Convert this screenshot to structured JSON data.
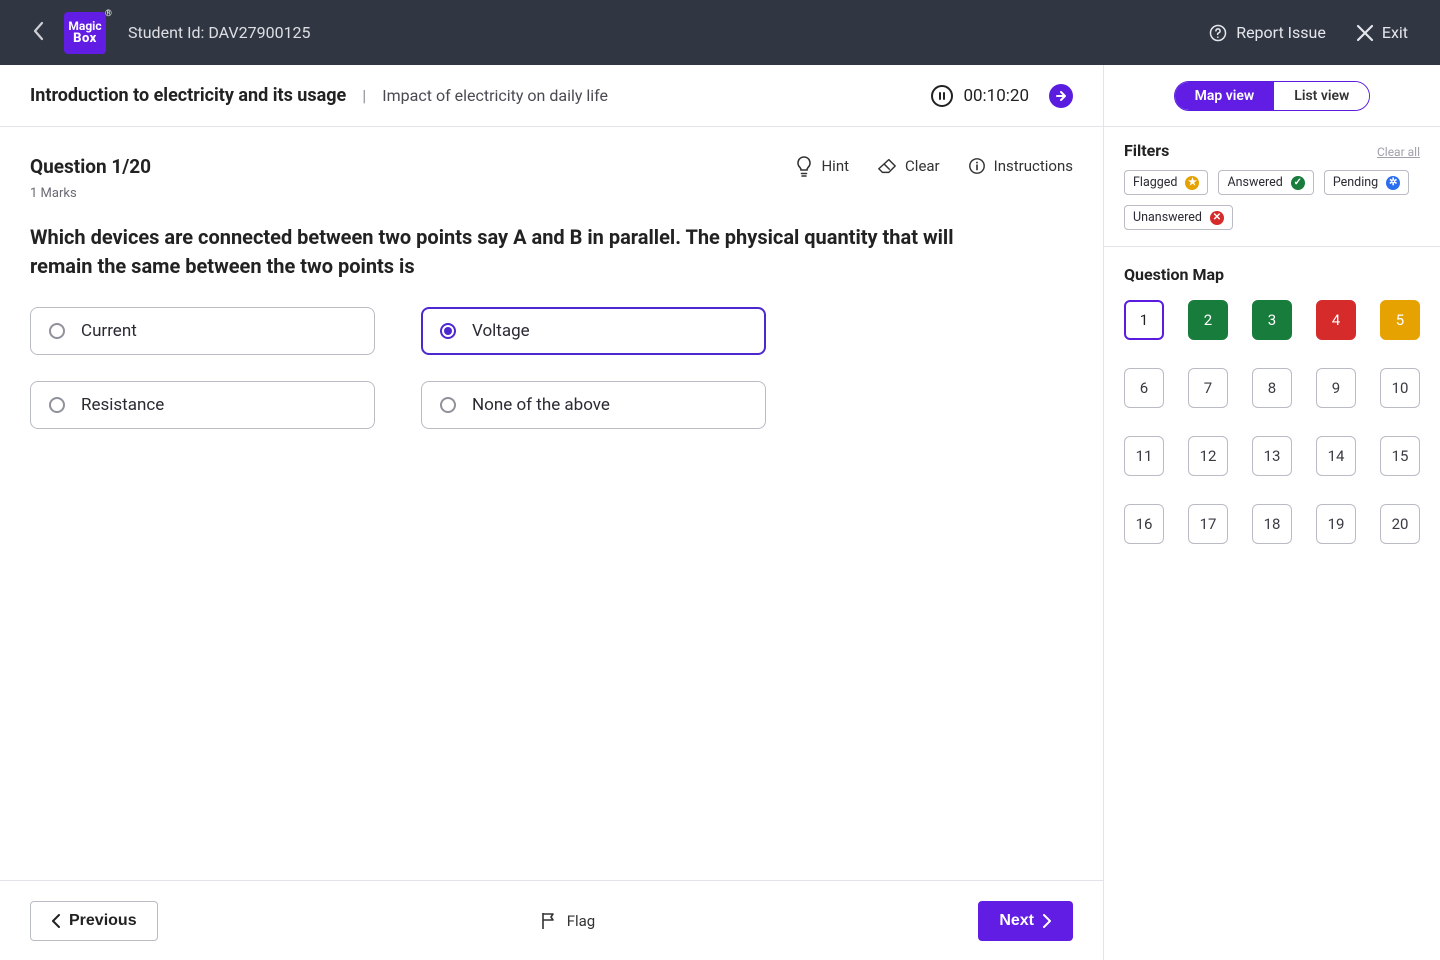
{
  "header": {
    "logo_top": "Magic",
    "logo_bottom": "Box",
    "student_id_label": "Student Id: DAV27900125",
    "report_label": "Report Issue",
    "exit_label": "Exit"
  },
  "subheader": {
    "course_title": "Introduction to electricity and its usage",
    "course_sub": "Impact of electricity on daily life",
    "timer": "00:10:20"
  },
  "question": {
    "number_label": "Question 1/20",
    "marks_label": "1 Marks",
    "hint_label": "Hint",
    "clear_label": "Clear",
    "instructions_label": "Instructions",
    "text": "Which devices are connected between two points say A and B in parallel. The physical quantity that will remain the same between the two points is",
    "options": [
      {
        "label": "Current",
        "selected": false
      },
      {
        "label": "Voltage",
        "selected": true
      },
      {
        "label": "Resistance",
        "selected": false
      },
      {
        "label": "None of the above",
        "selected": false
      }
    ]
  },
  "footer": {
    "prev_label": "Previous",
    "next_label": "Next",
    "flag_label": "Flag"
  },
  "view_toggle": {
    "map_label": "Map view",
    "list_label": "List view",
    "active": "map"
  },
  "filters": {
    "title": "Filters",
    "clear_all_label": "Clear all",
    "chips": [
      {
        "label": "Flagged",
        "dot": "flagged",
        "glyph": "★"
      },
      {
        "label": "Answered",
        "dot": "answered",
        "glyph": "✓"
      },
      {
        "label": "Pending",
        "dot": "pending",
        "glyph": "✲"
      },
      {
        "label": "Unanswered",
        "dot": "unanswered",
        "glyph": "✕"
      }
    ]
  },
  "question_map": {
    "title": "Question Map",
    "cells": [
      {
        "n": "1",
        "state": "current"
      },
      {
        "n": "2",
        "state": "answered"
      },
      {
        "n": "3",
        "state": "answered"
      },
      {
        "n": "4",
        "state": "unanswered"
      },
      {
        "n": "5",
        "state": "flagged"
      },
      {
        "n": "6",
        "state": ""
      },
      {
        "n": "7",
        "state": ""
      },
      {
        "n": "8",
        "state": ""
      },
      {
        "n": "9",
        "state": ""
      },
      {
        "n": "10",
        "state": ""
      },
      {
        "n": "11",
        "state": ""
      },
      {
        "n": "12",
        "state": ""
      },
      {
        "n": "13",
        "state": ""
      },
      {
        "n": "14",
        "state": ""
      },
      {
        "n": "15",
        "state": ""
      },
      {
        "n": "16",
        "state": ""
      },
      {
        "n": "17",
        "state": ""
      },
      {
        "n": "18",
        "state": ""
      },
      {
        "n": "19",
        "state": ""
      },
      {
        "n": "20",
        "state": ""
      }
    ]
  }
}
